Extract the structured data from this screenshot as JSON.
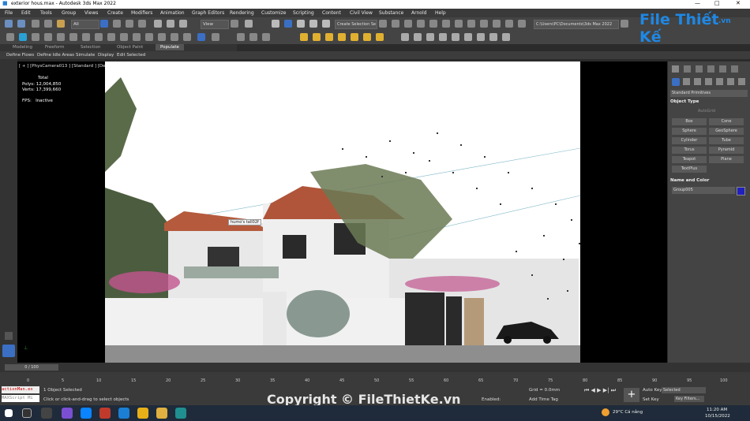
{
  "title_bar": {
    "title": "exterior hous.max - Autodesk 3ds Max 2022",
    "minimize": "—",
    "maximize": "□",
    "close": "✕"
  },
  "menu": [
    "File",
    "Edit",
    "Tools",
    "Group",
    "Views",
    "Create",
    "Modifiers",
    "Animation",
    "Graph Editors",
    "Rendering",
    "Customize",
    "Scripting",
    "Content",
    "Civil View",
    "Substance",
    "Arnold",
    "Help"
  ],
  "toolbar": {
    "filter_select": "All",
    "view_select": "View",
    "selection_set": "Create Selection Se",
    "path": "C:\\Users\\PC\\Documents\\3ds Max 2022"
  },
  "ribbon": {
    "tabs": [
      "Modeling",
      "Freeform",
      "Selection",
      "Object Paint",
      "Populate"
    ],
    "subtabs": [
      "Define Flows",
      "Define Idle Areas",
      "Simulate",
      "Display",
      "Edit Selected"
    ]
  },
  "viewport": {
    "label": "[ + ] [PhysCamera013 ] [Standard ] [Default Shading ]  <<Disabled>>",
    "stats": {
      "total_label": "Total",
      "polys_label": "Polys:",
      "polys": "12,004,850",
      "verts_label": "Verts:",
      "verts": "17,399,660",
      "fps_label": "FPS:",
      "fps": "Inactive"
    },
    "tooltip": "humo's tall02f"
  },
  "command_panel": {
    "dropdown": "Standard Primitives",
    "object_type_header": "Object Type",
    "autogrid": "AutoGrid",
    "buttons": [
      "Box",
      "Cone",
      "Sphere",
      "GeoSphere",
      "Cylinder",
      "Tube",
      "Torus",
      "Pyramid",
      "Teapot",
      "Plane",
      "TextPlus"
    ],
    "name_color_header": "Name and Color",
    "object_name": "Group005"
  },
  "timeline": {
    "frame_counter": "0 / 100",
    "ticks": [
      "0",
      "5",
      "10",
      "15",
      "20",
      "25",
      "30",
      "35",
      "40",
      "45",
      "50",
      "55",
      "60",
      "65",
      "70",
      "75",
      "80",
      "85",
      "90",
      "95",
      "100"
    ]
  },
  "status": {
    "script_box_1": "actionMan.ex",
    "script_box_2": "MAXScript Mi",
    "selection_info": "1 Object Selected",
    "prompt": "Click or click-and-drag to select objects",
    "grid": "Grid = 0.0mm",
    "enabled_label": "Enabled:",
    "add_time_tag": "Add Time Tag",
    "auto_key": "Auto Key",
    "set_key": "Set Key",
    "key_mode": "Selected",
    "key_filters": "Key Filters..."
  },
  "taskbar": {
    "weather": "29°C  Cá nắng",
    "time": "11:20 AM",
    "date": "10/15/2022"
  },
  "watermark": "Copyright © FileThietKe.vn",
  "logo": {
    "text": "File Thiết Kế",
    "suffix": ".vn"
  },
  "colors": {
    "viewport_bg": "#000000",
    "scene_bg": "#ffffff",
    "panel_bg": "#444444",
    "accent_blue": "#3b6fc4",
    "logo_blue": "#1e88e5",
    "object_color": "#2020c0"
  }
}
